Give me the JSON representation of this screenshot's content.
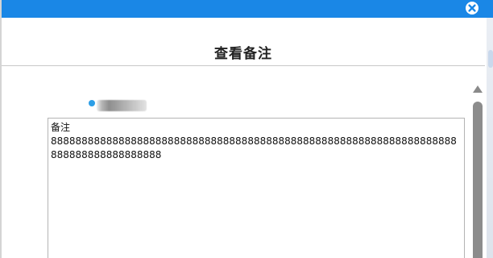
{
  "titlebar": {
    "close_icon": "close-icon",
    "color": "#1a87e6"
  },
  "dialog": {
    "title": "查看备注"
  },
  "user": {
    "name_obscured": true,
    "dot_color": "#2d9ee6"
  },
  "note": {
    "label": "备注",
    "text": "888888888888888888888888888888888888888888888888888888888888888888888888888888888888"
  },
  "scrollbar": {
    "up_icon": "scroll-up-icon"
  }
}
